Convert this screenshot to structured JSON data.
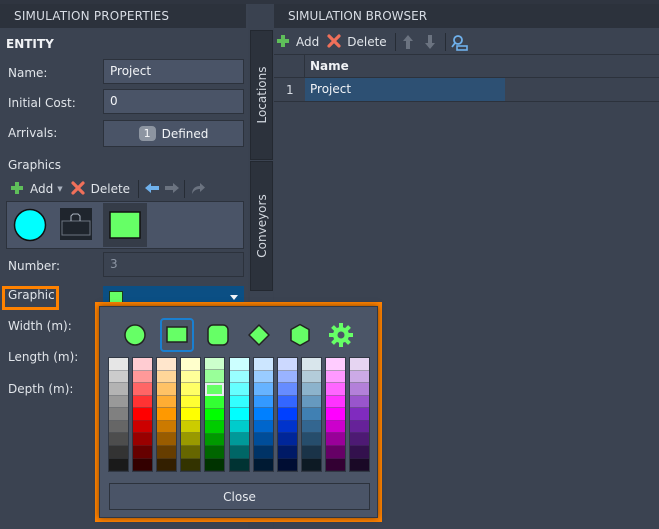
{
  "properties_panel": {
    "title": "SIMULATION PROPERTIES",
    "section": "ENTITY",
    "fields": {
      "name": {
        "label": "Name:",
        "value": "Project"
      },
      "initial_cost": {
        "label": "Initial Cost:",
        "value": "0"
      },
      "arrivals": {
        "label": "Arrivals:",
        "count": "1",
        "value": "Defined"
      },
      "number": {
        "label": "Number:",
        "value": "3"
      },
      "graphic": {
        "label": "Graphic:",
        "selected_color": "#66ff66"
      },
      "width": {
        "label": "Width (m):"
      },
      "length": {
        "label": "Length (m):"
      },
      "depth": {
        "label": "Depth (m):"
      }
    },
    "graphics": {
      "label": "Graphics",
      "toolbar": {
        "add": "Add",
        "delete": "Delete"
      },
      "items": [
        {
          "type": "circle",
          "color": "#00ffff"
        },
        {
          "type": "image",
          "color": "#1f252d"
        },
        {
          "type": "rectangle",
          "color": "#66ff66",
          "selected": true
        }
      ]
    }
  },
  "side_tabs": [
    "Locations",
    "Conveyors"
  ],
  "browser_panel": {
    "title": "SIMULATION BROWSER",
    "toolbar": {
      "add": "Add",
      "delete": "Delete"
    },
    "columns": [
      "Name"
    ],
    "rows": [
      {
        "index": "1",
        "name": "Project"
      }
    ]
  },
  "graphic_popup": {
    "shapes": [
      "circle",
      "rectangle",
      "rounded-square",
      "diamond",
      "hexagon",
      "gear"
    ],
    "selected_shape": "rectangle",
    "shape_color": "#66ff66",
    "palette": [
      [
        "#e6e6e6",
        "#cccccc",
        "#b3b3b3",
        "#999999",
        "#808080",
        "#666666",
        "#4d4d4d",
        "#333333",
        "#1a1a1a"
      ],
      [
        "#ffccd2",
        "#ff9999",
        "#ff6666",
        "#ff3333",
        "#ff0000",
        "#cc0000",
        "#990000",
        "#660000",
        "#330000"
      ],
      [
        "#ffe6cc",
        "#ffd699",
        "#ffc266",
        "#ffad33",
        "#ff9900",
        "#cc7a00",
        "#995c00",
        "#663d00",
        "#331f00"
      ],
      [
        "#ffffcc",
        "#ffff99",
        "#ffff66",
        "#ffff33",
        "#ffff00",
        "#cccc00",
        "#999900",
        "#666600",
        "#333300"
      ],
      [
        "#ccffcc",
        "#99ff99",
        "#66ff66",
        "#33ff33",
        "#00ff00",
        "#00cc00",
        "#009900",
        "#006600",
        "#003300"
      ],
      [
        "#ccffff",
        "#99ffff",
        "#66ffff",
        "#33ffff",
        "#00ffff",
        "#00cccc",
        "#009999",
        "#006666",
        "#003333"
      ],
      [
        "#cce6ff",
        "#99ccff",
        "#66b3ff",
        "#3399ff",
        "#0080ff",
        "#0066cc",
        "#004d99",
        "#003366",
        "#001a33"
      ],
      [
        "#ccd9ff",
        "#99b3ff",
        "#668cff",
        "#3366ff",
        "#0040ff",
        "#0033cc",
        "#002699",
        "#001a66",
        "#000d33"
      ],
      [
        "#d9e6ec",
        "#b3ccd9",
        "#8cb3cc",
        "#6699bf",
        "#4080b3",
        "#336690",
        "#264d6c",
        "#1a3348",
        "#0d1a24"
      ],
      [
        "#ffccff",
        "#ff99ff",
        "#ff66ff",
        "#ff33ff",
        "#ff00ff",
        "#cc00cc",
        "#990099",
        "#660066",
        "#330033"
      ],
      [
        "#e6d5f2",
        "#ccaae6",
        "#b380d9",
        "#9955cc",
        "#802bbf",
        "#662299",
        "#4d1a73",
        "#33114d",
        "#1a0926"
      ]
    ],
    "selected_palette_cell": [
      4,
      2
    ],
    "close_label": "Close"
  }
}
